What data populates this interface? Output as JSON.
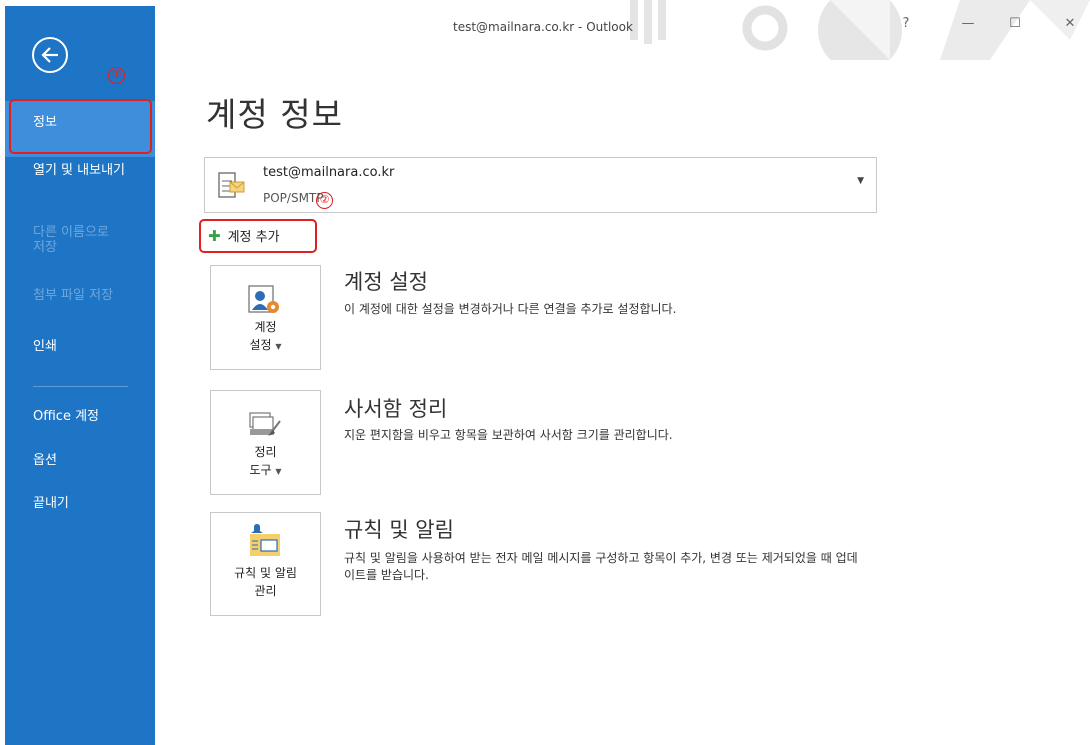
{
  "window": {
    "title": "test@mailnara.co.kr - Outlook",
    "help": "?",
    "minimize": "—",
    "maximize": "☐",
    "close": "✕"
  },
  "sidebar": {
    "items": [
      {
        "label": "정보"
      },
      {
        "label": "열기 및 내보내기"
      },
      {
        "label": "다른 이름으로 저장"
      },
      {
        "label": "첨부 파일 저장"
      },
      {
        "label": "인쇄"
      },
      {
        "label": "Office 계정"
      },
      {
        "label": "옵션"
      },
      {
        "label": "끝내기"
      }
    ]
  },
  "annotations": {
    "one": "①",
    "two": "②"
  },
  "main": {
    "title": "계정 정보",
    "account": {
      "email": "test@mailnara.co.kr",
      "type": "POP/SMTP"
    },
    "add_account": "계정 추가",
    "sections": [
      {
        "tile_line1": "계정",
        "tile_line2": "설정",
        "title": "계정 설정",
        "desc": "이 계정에 대한 설정을 변경하거나 다른 연결을 추가로 설정합니다."
      },
      {
        "tile_line1": "정리",
        "tile_line2": "도구",
        "title": "사서함 정리",
        "desc": "지운 편지함을 비우고 항목을 보관하여 사서함 크기를 관리합니다."
      },
      {
        "tile_line1": "규칙 및 알림",
        "tile_line2": "관리",
        "title": "규칙 및 알림",
        "desc": "규칙 및 알림을 사용하여 받는 전자 메일 메시지를 구성하고 항목이 추가, 변경 또는 제거되었을 때 업데이트를 받습니다."
      }
    ]
  }
}
